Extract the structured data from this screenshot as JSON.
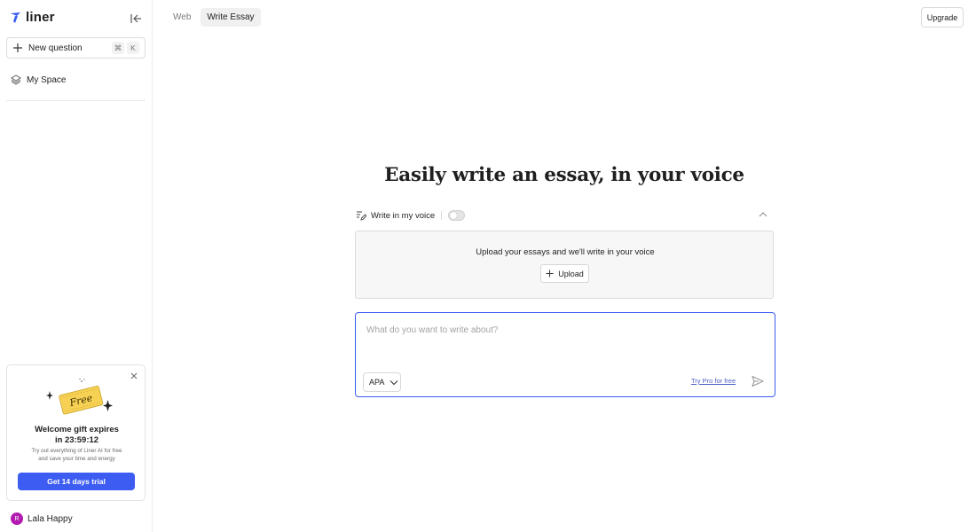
{
  "sidebar": {
    "logo_text": "liner",
    "new_question": {
      "label": "New question",
      "shortcut": [
        "⌘",
        "K"
      ]
    },
    "my_space": "My Space",
    "gift": {
      "title_line1": "Welcome gift expires",
      "title_line2": "in 23:59:12",
      "desc_line1": "Try out everything of Liner AI for free",
      "desc_line2": "and save your time and energy",
      "ticket_text": "Free",
      "cta": "Get 14 days trial"
    },
    "user": {
      "initial": "R",
      "name": "Lala Happy"
    }
  },
  "tabs": [
    {
      "label": "Web",
      "active": false
    },
    {
      "label": "Write Essay",
      "active": true
    }
  ],
  "header": {
    "upgrade": "Upgrade"
  },
  "main": {
    "headline": "Easily write an essay, in your voice",
    "voice": {
      "label": "Write in my voice",
      "enabled": false
    },
    "upload": {
      "text": "Upload your essays and we'll write in your voice",
      "button": "Upload"
    },
    "prompt": {
      "placeholder": "What do you want to write about?",
      "value": "",
      "citation_style": "APA",
      "try_pro": "Try Pro for free"
    }
  },
  "colors": {
    "accent": "#3d5cf2",
    "avatar": "#b21bb0",
    "ticket": "#f7d154"
  }
}
